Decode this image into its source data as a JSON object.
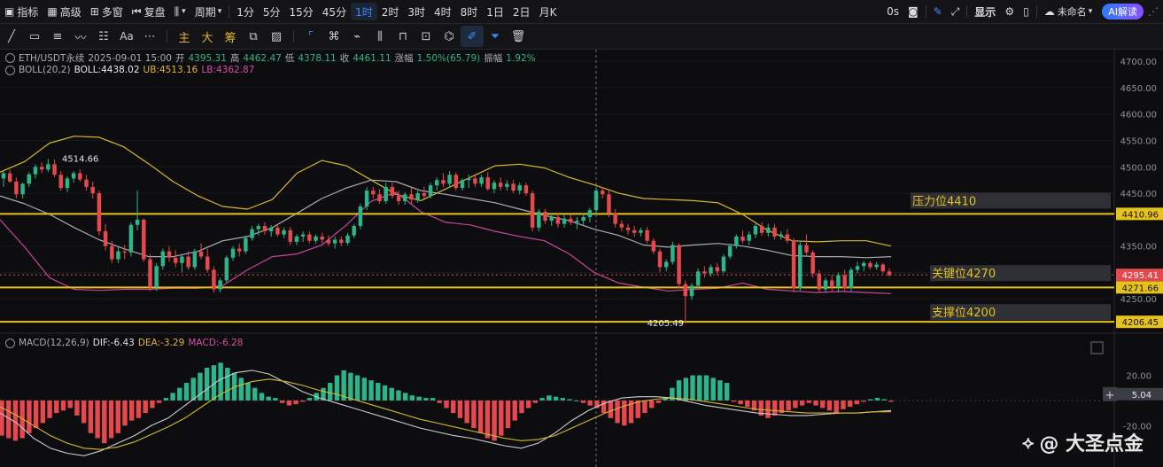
{
  "topbar": {
    "indicators": "指标",
    "advanced": "高级",
    "multi_window": "多窗",
    "replay": "复盘",
    "period": "周期",
    "intervals": [
      "1分",
      "5分",
      "15分",
      "45分",
      "1时",
      "2时",
      "3时",
      "4时",
      "8时",
      "1日",
      "2日",
      "月K"
    ],
    "active_interval": "1时",
    "timer": "0s",
    "save": "显示",
    "unnamed": "未命名",
    "ai": "AI解读"
  },
  "toolbar2": {
    "tool_main": "主",
    "tool_big": "大",
    "tool_raise": "筹"
  },
  "legend": {
    "symbol": "ETH/USDT永续",
    "datetime": "2025-09-01 15:00",
    "open_label": "开",
    "open": "4395.31",
    "high_label": "高",
    "high": "4462.47",
    "low_label": "低",
    "low": "4378.11",
    "close_label": "收",
    "close": "4461.11",
    "change_label": "涨幅",
    "change": "1.50%(65.79)",
    "amp_label": "振幅",
    "amp": "1.92%",
    "boll_name": "BOLL(20,2)",
    "boll": "BOLL:4438.02",
    "ub": "UB:4513.16",
    "lb": "LB:4362.87",
    "macd_name": "MACD(12,26,9)",
    "dif": "DIF:-6.43",
    "dea": "DEA:-3.29",
    "macd": "MACD:-6.28"
  },
  "annotations": {
    "high_mark": "4514.66",
    "low_mark": "4205.49",
    "resistance": "压力位4410",
    "key": "关键位4270",
    "support": "支撑位4200"
  },
  "watermark": "@ 大圣点金",
  "colors": {
    "up": "#2bb589",
    "down": "#e5484d",
    "ub": "#d8b72e",
    "lb": "#c9449e",
    "mid": "#a9acb2",
    "hline": "#e6c21c",
    "bg": "#0d0d0f"
  },
  "chart_data": {
    "type": "candlestick",
    "price_axis": {
      "ticks": [
        4700,
        4650,
        4600,
        4550,
        4500,
        4450,
        4350,
        4300,
        4250
      ],
      "ylim": [
        4195,
        4712
      ]
    },
    "price_labels": [
      {
        "value": 4410.96,
        "text": "4410.96",
        "style": "yellow"
      },
      {
        "value": 4295.41,
        "text": "4295.41",
        "style": "red"
      },
      {
        "value": 4271.66,
        "text": "4271.66",
        "style": "yellow"
      },
      {
        "value": 4206.45,
        "text": "4206.45",
        "style": "yellow"
      }
    ],
    "horizontal_lines": [
      4410.96,
      4271.66,
      4206.45
    ],
    "current_price": 4295.41,
    "candles": [
      {
        "o": 4478,
        "h": 4492,
        "l": 4462,
        "c": 4488
      },
      {
        "o": 4488,
        "h": 4495,
        "l": 4470,
        "c": 4472
      },
      {
        "o": 4472,
        "h": 4480,
        "l": 4440,
        "c": 4448
      },
      {
        "o": 4448,
        "h": 4470,
        "l": 4440,
        "c": 4468
      },
      {
        "o": 4468,
        "h": 4490,
        "l": 4462,
        "c": 4486
      },
      {
        "o": 4486,
        "h": 4505,
        "l": 4478,
        "c": 4500
      },
      {
        "o": 4500,
        "h": 4508,
        "l": 4488,
        "c": 4495
      },
      {
        "o": 4495,
        "h": 4515,
        "l": 4490,
        "c": 4505
      },
      {
        "o": 4505,
        "h": 4514,
        "l": 4480,
        "c": 4485
      },
      {
        "o": 4485,
        "h": 4492,
        "l": 4455,
        "c": 4460
      },
      {
        "o": 4460,
        "h": 4482,
        "l": 4452,
        "c": 4478
      },
      {
        "o": 4478,
        "h": 4492,
        "l": 4470,
        "c": 4488
      },
      {
        "o": 4488,
        "h": 4495,
        "l": 4472,
        "c": 4476
      },
      {
        "o": 4476,
        "h": 4485,
        "l": 4455,
        "c": 4462
      },
      {
        "o": 4462,
        "h": 4472,
        "l": 4440,
        "c": 4450
      },
      {
        "o": 4450,
        "h": 4455,
        "l": 4370,
        "c": 4378
      },
      {
        "o": 4378,
        "h": 4392,
        "l": 4342,
        "c": 4350
      },
      {
        "o": 4350,
        "h": 4360,
        "l": 4318,
        "c": 4325
      },
      {
        "o": 4325,
        "h": 4348,
        "l": 4318,
        "c": 4340
      },
      {
        "o": 4340,
        "h": 4352,
        "l": 4325,
        "c": 4338
      },
      {
        "o": 4338,
        "h": 4395,
        "l": 4330,
        "c": 4390
      },
      {
        "o": 4390,
        "h": 4455,
        "l": 4380,
        "c": 4400
      },
      {
        "o": 4400,
        "h": 4402,
        "l": 4320,
        "c": 4325
      },
      {
        "o": 4325,
        "h": 4335,
        "l": 4265,
        "c": 4272
      },
      {
        "o": 4272,
        "h": 4318,
        "l": 4265,
        "c": 4312
      },
      {
        "o": 4312,
        "h": 4345,
        "l": 4305,
        "c": 4340
      },
      {
        "o": 4340,
        "h": 4350,
        "l": 4320,
        "c": 4328
      },
      {
        "o": 4328,
        "h": 4342,
        "l": 4310,
        "c": 4318
      },
      {
        "o": 4318,
        "h": 4335,
        "l": 4300,
        "c": 4330
      },
      {
        "o": 4330,
        "h": 4340,
        "l": 4305,
        "c": 4310
      },
      {
        "o": 4310,
        "h": 4345,
        "l": 4305,
        "c": 4340
      },
      {
        "o": 4340,
        "h": 4355,
        "l": 4325,
        "c": 4330
      },
      {
        "o": 4330,
        "h": 4345,
        "l": 4300,
        "c": 4305
      },
      {
        "o": 4305,
        "h": 4312,
        "l": 4262,
        "c": 4268
      },
      {
        "o": 4268,
        "h": 4290,
        "l": 4262,
        "c": 4285
      },
      {
        "o": 4285,
        "h": 4332,
        "l": 4280,
        "c": 4328
      },
      {
        "o": 4328,
        "h": 4350,
        "l": 4322,
        "c": 4345
      },
      {
        "o": 4345,
        "h": 4355,
        "l": 4330,
        "c": 4340
      },
      {
        "o": 4340,
        "h": 4370,
        "l": 4335,
        "c": 4365
      },
      {
        "o": 4365,
        "h": 4388,
        "l": 4360,
        "c": 4382
      },
      {
        "o": 4382,
        "h": 4392,
        "l": 4370,
        "c": 4388
      },
      {
        "o": 4388,
        "h": 4395,
        "l": 4372,
        "c": 4378
      },
      {
        "o": 4378,
        "h": 4390,
        "l": 4368,
        "c": 4385
      },
      {
        "o": 4385,
        "h": 4390,
        "l": 4368,
        "c": 4372
      },
      {
        "o": 4372,
        "h": 4385,
        "l": 4365,
        "c": 4380
      },
      {
        "o": 4380,
        "h": 4386,
        "l": 4352,
        "c": 4358
      },
      {
        "o": 4358,
        "h": 4372,
        "l": 4352,
        "c": 4368
      },
      {
        "o": 4368,
        "h": 4378,
        "l": 4358,
        "c": 4372
      },
      {
        "o": 4372,
        "h": 4378,
        "l": 4355,
        "c": 4360
      },
      {
        "o": 4360,
        "h": 4372,
        "l": 4355,
        "c": 4368
      },
      {
        "o": 4368,
        "h": 4375,
        "l": 4355,
        "c": 4362
      },
      {
        "o": 4362,
        "h": 4370,
        "l": 4350,
        "c": 4355
      },
      {
        "o": 4355,
        "h": 4368,
        "l": 4345,
        "c": 4362
      },
      {
        "o": 4362,
        "h": 4368,
        "l": 4350,
        "c": 4356
      },
      {
        "o": 4356,
        "h": 4375,
        "l": 4352,
        "c": 4370
      },
      {
        "o": 4370,
        "h": 4392,
        "l": 4365,
        "c": 4388
      },
      {
        "o": 4388,
        "h": 4430,
        "l": 4382,
        "c": 4425
      },
      {
        "o": 4425,
        "h": 4462,
        "l": 4418,
        "c": 4455
      },
      {
        "o": 4455,
        "h": 4462,
        "l": 4440,
        "c": 4448
      },
      {
        "o": 4448,
        "h": 4458,
        "l": 4430,
        "c": 4435
      },
      {
        "o": 4435,
        "h": 4470,
        "l": 4430,
        "c": 4462
      },
      {
        "o": 4462,
        "h": 4470,
        "l": 4440,
        "c": 4445
      },
      {
        "o": 4445,
        "h": 4455,
        "l": 4428,
        "c": 4435
      },
      {
        "o": 4435,
        "h": 4452,
        "l": 4428,
        "c": 4448
      },
      {
        "o": 4448,
        "h": 4460,
        "l": 4430,
        "c": 4438
      },
      {
        "o": 4438,
        "h": 4455,
        "l": 4432,
        "c": 4450
      },
      {
        "o": 4450,
        "h": 4462,
        "l": 4440,
        "c": 4445
      },
      {
        "o": 4445,
        "h": 4470,
        "l": 4440,
        "c": 4465
      },
      {
        "o": 4465,
        "h": 4480,
        "l": 4455,
        "c": 4475
      },
      {
        "o": 4475,
        "h": 4488,
        "l": 4462,
        "c": 4468
      },
      {
        "o": 4468,
        "h": 4492,
        "l": 4460,
        "c": 4485
      },
      {
        "o": 4485,
        "h": 4490,
        "l": 4455,
        "c": 4460
      },
      {
        "o": 4460,
        "h": 4478,
        "l": 4455,
        "c": 4475
      },
      {
        "o": 4475,
        "h": 4485,
        "l": 4460,
        "c": 4478
      },
      {
        "o": 4478,
        "h": 4486,
        "l": 4462,
        "c": 4468
      },
      {
        "o": 4468,
        "h": 4485,
        "l": 4462,
        "c": 4480
      },
      {
        "o": 4480,
        "h": 4490,
        "l": 4455,
        "c": 4458
      },
      {
        "o": 4458,
        "h": 4475,
        "l": 4450,
        "c": 4470
      },
      {
        "o": 4470,
        "h": 4480,
        "l": 4455,
        "c": 4462
      },
      {
        "o": 4462,
        "h": 4475,
        "l": 4455,
        "c": 4468
      },
      {
        "o": 4468,
        "h": 4475,
        "l": 4450,
        "c": 4455
      },
      {
        "o": 4455,
        "h": 4470,
        "l": 4448,
        "c": 4465
      },
      {
        "o": 4465,
        "h": 4470,
        "l": 4445,
        "c": 4450
      },
      {
        "o": 4450,
        "h": 4455,
        "l": 4378,
        "c": 4385
      },
      {
        "o": 4385,
        "h": 4420,
        "l": 4378,
        "c": 4415
      },
      {
        "o": 4415,
        "h": 4420,
        "l": 4392,
        "c": 4398
      },
      {
        "o": 4398,
        "h": 4412,
        "l": 4388,
        "c": 4405
      },
      {
        "o": 4405,
        "h": 4412,
        "l": 4385,
        "c": 4392
      },
      {
        "o": 4392,
        "h": 4410,
        "l": 4385,
        "c": 4402
      },
      {
        "o": 4402,
        "h": 4410,
        "l": 4390,
        "c": 4395
      },
      {
        "o": 4395,
        "h": 4405,
        "l": 4382,
        "c": 4398
      },
      {
        "o": 4398,
        "h": 4412,
        "l": 4390,
        "c": 4405
      },
      {
        "o": 4405,
        "h": 4422,
        "l": 4395,
        "c": 4418
      },
      {
        "o": 4418,
        "h": 4462,
        "l": 4410,
        "c": 4455
      },
      {
        "o": 4455,
        "h": 4462,
        "l": 4440,
        "c": 4448
      },
      {
        "o": 4448,
        "h": 4456,
        "l": 4405,
        "c": 4412
      },
      {
        "o": 4412,
        "h": 4420,
        "l": 4385,
        "c": 4392
      },
      {
        "o": 4392,
        "h": 4398,
        "l": 4378,
        "c": 4385
      },
      {
        "o": 4385,
        "h": 4392,
        "l": 4372,
        "c": 4380
      },
      {
        "o": 4380,
        "h": 4388,
        "l": 4368,
        "c": 4375
      },
      {
        "o": 4375,
        "h": 4385,
        "l": 4368,
        "c": 4380
      },
      {
        "o": 4380,
        "h": 4386,
        "l": 4355,
        "c": 4360
      },
      {
        "o": 4360,
        "h": 4365,
        "l": 4335,
        "c": 4340
      },
      {
        "o": 4340,
        "h": 4345,
        "l": 4300,
        "c": 4310
      },
      {
        "o": 4310,
        "h": 4325,
        "l": 4302,
        "c": 4320
      },
      {
        "o": 4320,
        "h": 4358,
        "l": 4315,
        "c": 4352
      },
      {
        "o": 4352,
        "h": 4355,
        "l": 4270,
        "c": 4278
      },
      {
        "o": 4278,
        "h": 4285,
        "l": 4205,
        "c": 4255
      },
      {
        "o": 4255,
        "h": 4280,
        "l": 4248,
        "c": 4275
      },
      {
        "o": 4275,
        "h": 4308,
        "l": 4270,
        "c": 4302
      },
      {
        "o": 4302,
        "h": 4312,
        "l": 4290,
        "c": 4298
      },
      {
        "o": 4298,
        "h": 4315,
        "l": 4292,
        "c": 4310
      },
      {
        "o": 4310,
        "h": 4318,
        "l": 4295,
        "c": 4302
      },
      {
        "o": 4302,
        "h": 4335,
        "l": 4298,
        "c": 4330
      },
      {
        "o": 4330,
        "h": 4355,
        "l": 4325,
        "c": 4350
      },
      {
        "o": 4350,
        "h": 4372,
        "l": 4345,
        "c": 4368
      },
      {
        "o": 4368,
        "h": 4380,
        "l": 4355,
        "c": 4360
      },
      {
        "o": 4360,
        "h": 4378,
        "l": 4352,
        "c": 4372
      },
      {
        "o": 4372,
        "h": 4392,
        "l": 4365,
        "c": 4388
      },
      {
        "o": 4388,
        "h": 4395,
        "l": 4370,
        "c": 4375
      },
      {
        "o": 4375,
        "h": 4392,
        "l": 4368,
        "c": 4385
      },
      {
        "o": 4385,
        "h": 4392,
        "l": 4362,
        "c": 4368
      },
      {
        "o": 4368,
        "h": 4378,
        "l": 4362,
        "c": 4372
      },
      {
        "o": 4372,
        "h": 4382,
        "l": 4355,
        "c": 4360
      },
      {
        "o": 4360,
        "h": 4365,
        "l": 4262,
        "c": 4270
      },
      {
        "o": 4270,
        "h": 4360,
        "l": 4265,
        "c": 4352
      },
      {
        "o": 4352,
        "h": 4372,
        "l": 4330,
        "c": 4338
      },
      {
        "o": 4338,
        "h": 4342,
        "l": 4290,
        "c": 4298
      },
      {
        "o": 4298,
        "h": 4305,
        "l": 4262,
        "c": 4268
      },
      {
        "o": 4268,
        "h": 4290,
        "l": 4262,
        "c": 4285
      },
      {
        "o": 4285,
        "h": 4295,
        "l": 4265,
        "c": 4272
      },
      {
        "o": 4272,
        "h": 4300,
        "l": 4262,
        "c": 4295
      },
      {
        "o": 4295,
        "h": 4305,
        "l": 4265,
        "c": 4270
      },
      {
        "o": 4270,
        "h": 4310,
        "l": 4265,
        "c": 4305
      },
      {
        "o": 4305,
        "h": 4320,
        "l": 4298,
        "c": 4312
      },
      {
        "o": 4312,
        "h": 4322,
        "l": 4302,
        "c": 4318
      },
      {
        "o": 4318,
        "h": 4322,
        "l": 4305,
        "c": 4310
      },
      {
        "o": 4310,
        "h": 4320,
        "l": 4305,
        "c": 4315
      },
      {
        "o": 4315,
        "h": 4318,
        "l": 4298,
        "c": 4302
      },
      {
        "o": 4302,
        "h": 4308,
        "l": 4292,
        "c": 4295
      }
    ],
    "bollinger": {
      "ub": [
        4490,
        4510,
        4545,
        4558,
        4556,
        4538,
        4506,
        4472,
        4445,
        4425,
        4420,
        4438,
        4488,
        4512,
        4502,
        4475,
        4448,
        4436,
        4458,
        4480,
        4502,
        4505,
        4498,
        4480,
        4466,
        4450,
        4440,
        4438,
        4436,
        4432,
        4410,
        4380,
        4360,
        4358,
        4360,
        4360,
        4350
      ],
      "mid": [
        4445,
        4430,
        4410,
        4385,
        4362,
        4345,
        4330,
        4330,
        4340,
        4360,
        4368,
        4385,
        4412,
        4440,
        4460,
        4475,
        4472,
        4455,
        4448,
        4440,
        4432,
        4420,
        4408,
        4398,
        4382,
        4370,
        4352,
        4348,
        4352,
        4355,
        4350,
        4342,
        4332,
        4330,
        4330,
        4328,
        4330
      ],
      "lb": [
        4400,
        4348,
        4290,
        4268,
        4266,
        4268,
        4268,
        4270,
        4270,
        4275,
        4305,
        4330,
        4335,
        4352,
        4390,
        4435,
        4452,
        4415,
        4395,
        4390,
        4378,
        4368,
        4360,
        4335,
        4300,
        4280,
        4272,
        4265,
        4268,
        4270,
        4280,
        4268,
        4265,
        4262,
        4264,
        4262,
        4260
      ]
    },
    "macd_axis": {
      "ticks": [
        20.0,
        5.04,
        -20.0
      ],
      "ylim": [
        -48,
        38
      ]
    },
    "macd": {
      "current": 5.04,
      "hist": [
        -28,
        -30,
        -32,
        -30,
        -26,
        -22,
        -18,
        -14,
        -10,
        -8,
        -6,
        -12,
        -18,
        -26,
        -30,
        -34,
        -30,
        -26,
        -20,
        -16,
        -14,
        -10,
        -6,
        -2,
        2,
        6,
        10,
        14,
        18,
        22,
        26,
        28,
        30,
        26,
        22,
        18,
        14,
        10,
        6,
        3,
        2,
        -2,
        -4,
        -3,
        -1,
        2,
        6,
        10,
        14,
        20,
        24,
        22,
        20,
        18,
        16,
        14,
        12,
        10,
        8,
        6,
        4,
        3,
        2,
        2,
        -2,
        -6,
        -10,
        -14,
        -18,
        -22,
        -26,
        -30,
        -32,
        -28,
        -22,
        -16,
        -10,
        -6,
        -2,
        2,
        4,
        3,
        2,
        1,
        0,
        -2,
        -4,
        -6,
        -10,
        -14,
        -18,
        -20,
        -18,
        -14,
        -10,
        -6,
        -2,
        2,
        10,
        16,
        18,
        20,
        20,
        20,
        18,
        16,
        14,
        -1,
        -3,
        -5,
        -8,
        -12,
        -14,
        -12,
        -10,
        -8,
        -6,
        -4,
        -2,
        -4,
        -6,
        -8,
        -10,
        -7,
        -5,
        -3,
        -1,
        1,
        2,
        1,
        -1
      ],
      "dif": [
        -10,
        -18,
        -30,
        -38,
        -42,
        -44,
        -40,
        -34,
        -28,
        -20,
        -14,
        -4,
        6,
        16,
        22,
        24,
        21,
        14,
        7,
        2,
        -2,
        -6,
        -10,
        -14,
        -18,
        -22,
        -25,
        -28,
        -30,
        -33,
        -36,
        -38,
        -34,
        -26,
        -16,
        -8,
        -2,
        2,
        3,
        3,
        2,
        -1,
        -4,
        -6,
        -8,
        -10,
        -11,
        -12,
        -12,
        -11,
        -10,
        -10,
        -9,
        -8
      ],
      "dea": [
        -5,
        -12,
        -20,
        -28,
        -34,
        -38,
        -39,
        -37,
        -33,
        -27,
        -21,
        -14,
        -5,
        4,
        11,
        15,
        17,
        15,
        12,
        8,
        5,
        1,
        -3,
        -7,
        -11,
        -15,
        -18,
        -21,
        -24,
        -27,
        -30,
        -32,
        -31,
        -28,
        -22,
        -16,
        -10,
        -5,
        -1,
        1,
        2,
        1,
        -1,
        -3,
        -5,
        -7,
        -8,
        -9,
        -10,
        -10,
        -10,
        -10,
        -9,
        -9
      ]
    }
  }
}
